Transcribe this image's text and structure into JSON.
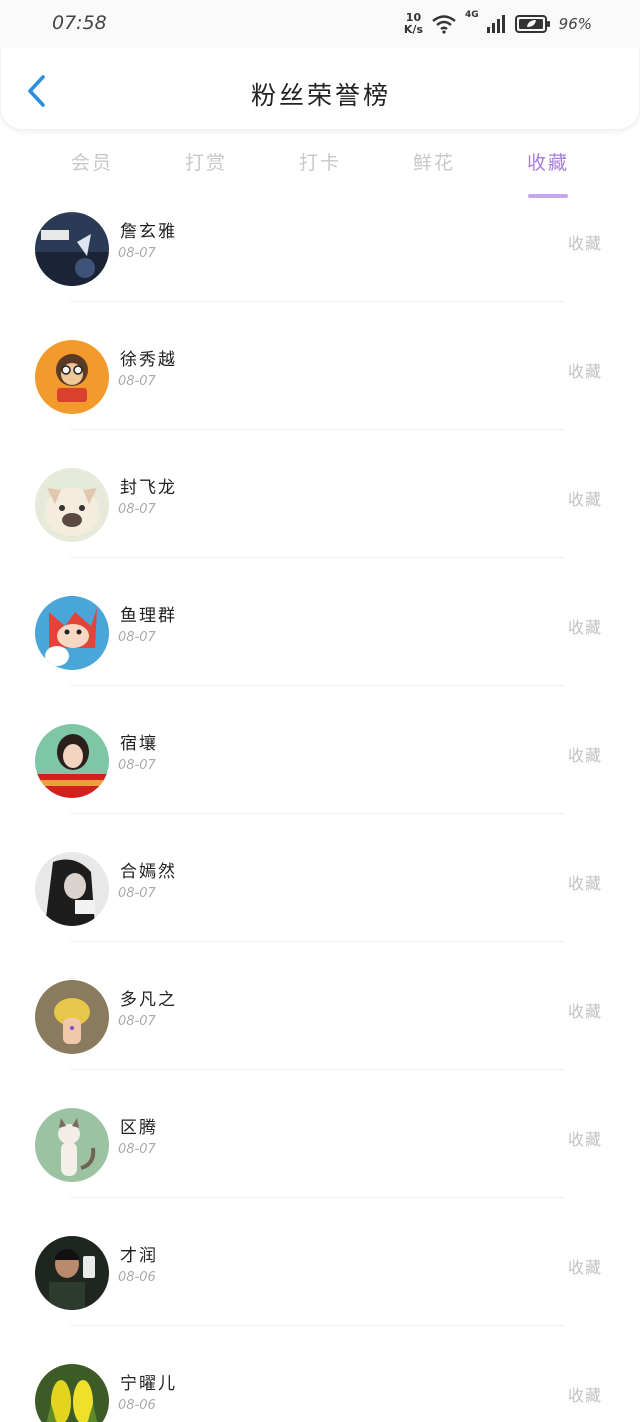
{
  "status_bar": {
    "time": "07:58",
    "net_speed_value": "10",
    "net_speed_unit": "K/s",
    "network_type": "4G",
    "battery_percent": "96%"
  },
  "header": {
    "title": "粉丝荣誉榜"
  },
  "tabs": [
    {
      "label": "会员"
    },
    {
      "label": "打赏"
    },
    {
      "label": "打卡"
    },
    {
      "label": "鲜花"
    },
    {
      "label": "收藏",
      "active": true
    }
  ],
  "colors": {
    "accent": "#a67fd8",
    "underline": "#c8a6ec",
    "muted": "#c2c2c2",
    "back_arrow": "#2a8fe0"
  },
  "fans": [
    {
      "name": "詹玄雅",
      "date": "08-07",
      "action": "收藏",
      "avatar_icon": "dark-photo-avatar"
    },
    {
      "name": "徐秀越",
      "date": "08-07",
      "action": "收藏",
      "avatar_icon": "monkey-cartoon-avatar"
    },
    {
      "name": "封飞龙",
      "date": "08-07",
      "action": "收藏",
      "avatar_icon": "bulldog-avatar"
    },
    {
      "name": "鱼理群",
      "date": "08-07",
      "action": "收藏",
      "avatar_icon": "fox-cartoon-avatar"
    },
    {
      "name": "宿壤",
      "date": "08-07",
      "action": "收藏",
      "avatar_icon": "girl-photo-avatar"
    },
    {
      "name": "合嫣然",
      "date": "08-07",
      "action": "收藏",
      "avatar_icon": "girl-bw-photo-avatar"
    },
    {
      "name": "多凡之",
      "date": "08-07",
      "action": "收藏",
      "avatar_icon": "mushroom-avatar"
    },
    {
      "name": "区腾",
      "date": "08-07",
      "action": "收藏",
      "avatar_icon": "cat-avatar"
    },
    {
      "name": "才润",
      "date": "08-06",
      "action": "收藏",
      "avatar_icon": "man-selfie-avatar"
    },
    {
      "name": "宁曜儿",
      "date": "08-06",
      "action": "收藏",
      "avatar_icon": "corn-avatar"
    }
  ]
}
